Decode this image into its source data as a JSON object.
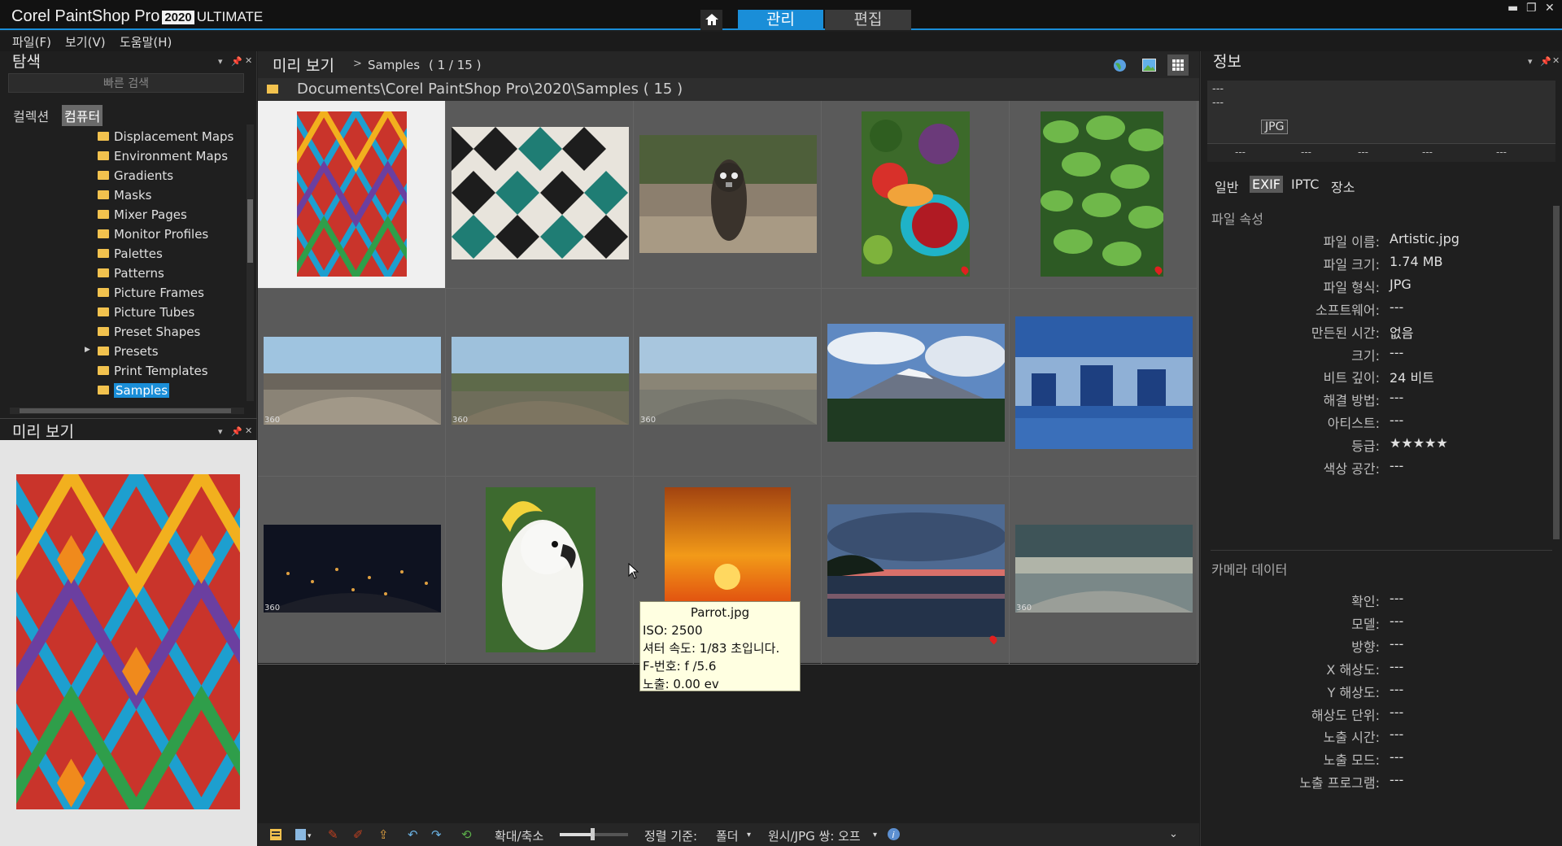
{
  "app": {
    "brand": "Corel PaintShop Pro",
    "year": "2020",
    "edition": "ULTIMATE"
  },
  "tabs": {
    "manage": "관리",
    "edit": "편집"
  },
  "menu": [
    "파일(F)",
    "보기(V)",
    "도움말(H)"
  ],
  "navigation": {
    "title": "탐색",
    "search_placeholder": "빠른 검색",
    "tabs": [
      "컬렉션",
      "컴퓨터"
    ],
    "folders": [
      "Displacement Maps",
      "Environment Maps",
      "Gradients",
      "Masks",
      "Mixer Pages",
      "Monitor Profiles",
      "Palettes",
      "Patterns",
      "Picture Frames",
      "Picture Tubes",
      "Preset Shapes",
      "Presets",
      "Print Templates",
      "Samples"
    ]
  },
  "preview_panel": {
    "title": "미리 보기"
  },
  "center": {
    "title": "미리 보기",
    "breadcrumb": "Samples",
    "count": "( 1 / 15 )",
    "path": "Documents\\Corel PaintShop Pro\\2020\\Samples ( 15 )"
  },
  "tooltip": {
    "name": "Parrot.jpg",
    "iso": "ISO: 2500",
    "shutter": "셔터 속도:  1/83 초입니다.",
    "fnum": "F-번호: f /5.6",
    "exposure": "노출: 0.00 ev"
  },
  "statusbar": {
    "zoom": "확대/축소",
    "sort_label": "정렬 기준:",
    "sort_value": "폴더",
    "raw_pair": "원시/JPG 쌍: 오프"
  },
  "info": {
    "title": "정보",
    "card_dashes": [
      "---",
      "---"
    ],
    "card_format": "JPG",
    "card_values": [
      "---",
      "---",
      "---",
      "---",
      "---"
    ],
    "tabs": [
      "일반",
      "EXIF",
      "IPTC",
      "장소"
    ],
    "file_section": "파일 속성",
    "file_props": [
      {
        "label": "파일 이름:",
        "value": "Artistic.jpg"
      },
      {
        "label": "파일 크기:",
        "value": "1.74 MB"
      },
      {
        "label": "파일 형식:",
        "value": "JPG"
      },
      {
        "label": "소프트웨어:",
        "value": "---"
      },
      {
        "label": "만든된 시간:",
        "value": "없음"
      },
      {
        "label": "크기:",
        "value": "---"
      },
      {
        "label": "비트 깊이:",
        "value": "24 비트"
      },
      {
        "label": "해결 방법:",
        "value": "---"
      },
      {
        "label": "아티스트:",
        "value": "---"
      },
      {
        "label": "등급:",
        "value": "★★★★★"
      },
      {
        "label": "색상 공간:",
        "value": "---"
      }
    ],
    "camera_section": "카메라 데이터",
    "camera_props": [
      {
        "label": "확인:",
        "value": "---"
      },
      {
        "label": "모델:",
        "value": "---"
      },
      {
        "label": "방향:",
        "value": "---"
      },
      {
        "label": "X 해상도:",
        "value": "---"
      },
      {
        "label": "Y 해상도:",
        "value": "---"
      },
      {
        "label": "해상도 단위:",
        "value": "---"
      },
      {
        "label": "노출 시간:",
        "value": "---"
      },
      {
        "label": "노출 모드:",
        "value": "---"
      },
      {
        "label": "노출 프로그램:",
        "value": "---"
      }
    ]
  }
}
